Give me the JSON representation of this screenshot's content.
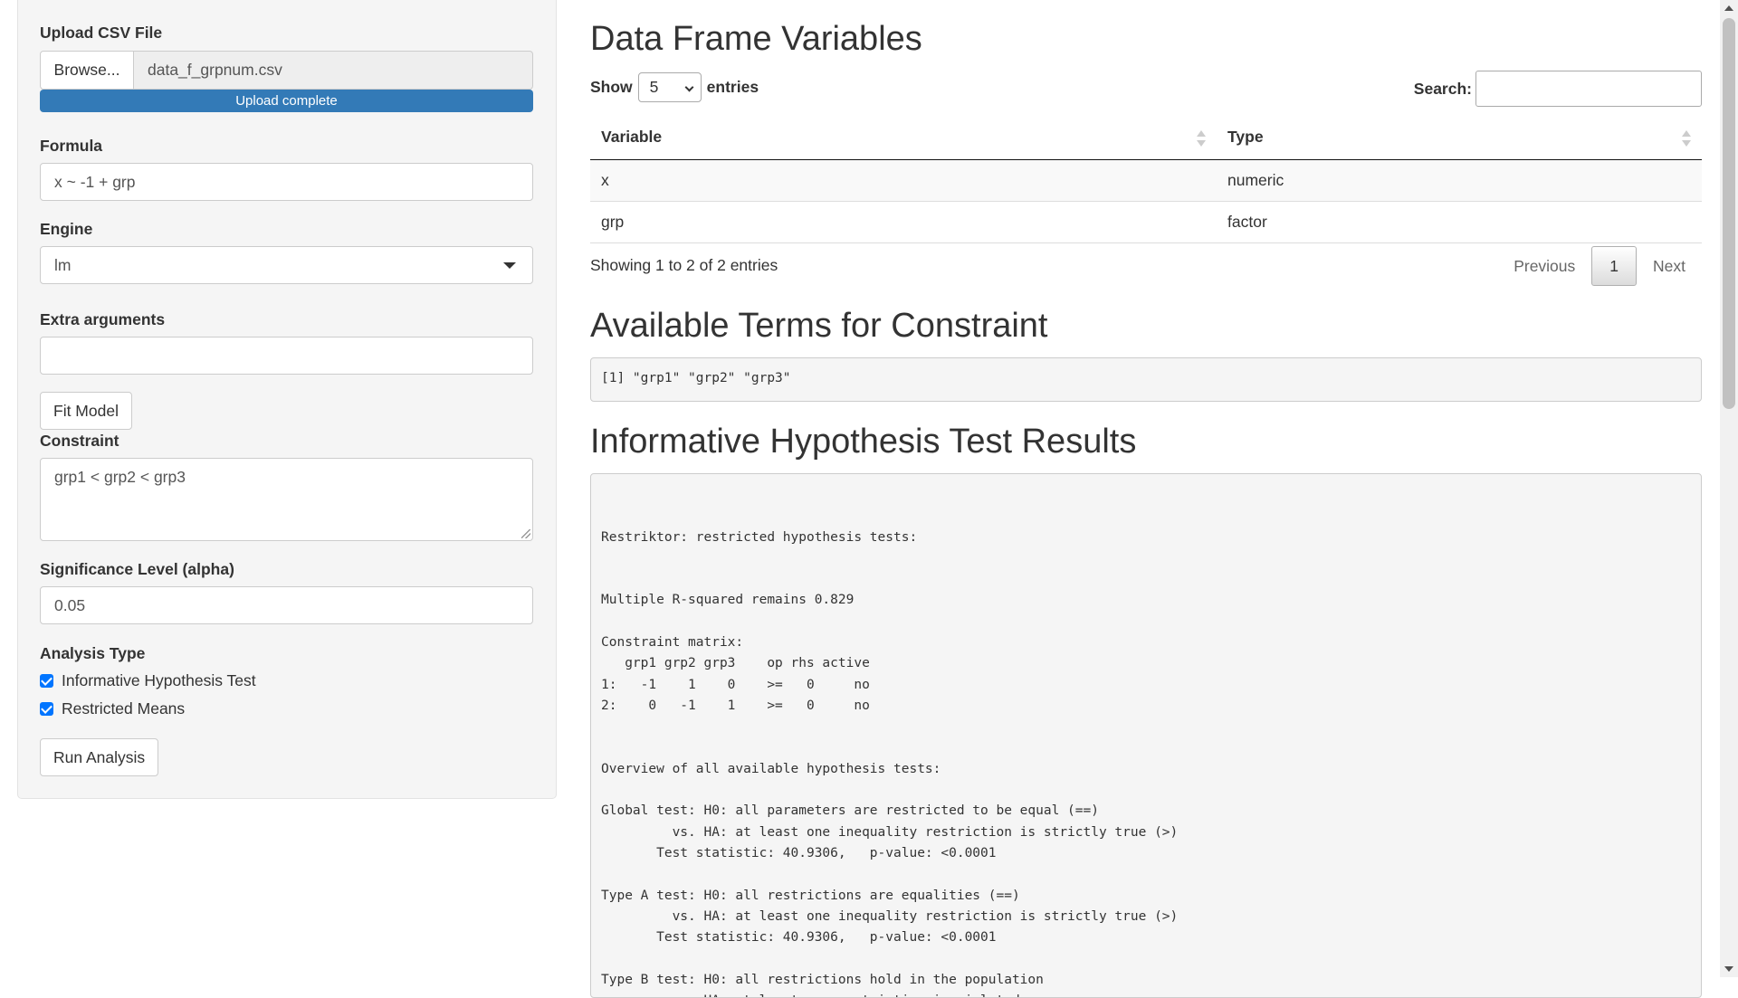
{
  "sidebar": {
    "upload": {
      "label": "Upload CSV File",
      "browse_label": "Browse...",
      "file_name": "data_f_grpnum.csv",
      "progress_text": "Upload complete",
      "progress_percent": 100
    },
    "formula": {
      "label": "Formula",
      "value": "x ~ -1 + grp"
    },
    "engine": {
      "label": "Engine",
      "value": "lm"
    },
    "extra_args": {
      "label": "Extra arguments",
      "value": ""
    },
    "fit_button": "Fit Model",
    "constraint": {
      "label": "Constraint",
      "value": "grp1 < grp2 < grp3"
    },
    "alpha": {
      "label": "Significance Level (alpha)",
      "value": "0.05"
    },
    "analysis_type": {
      "label": "Analysis Type",
      "options": [
        {
          "label": "Informative Hypothesis Test",
          "checked": true
        },
        {
          "label": "Restricted Means",
          "checked": true
        }
      ]
    },
    "run_button": "Run Analysis"
  },
  "main": {
    "df_title": "Data Frame Variables",
    "show_label": "Show",
    "entries_value": "5",
    "entries_label": "entries",
    "search_label": "Search:",
    "table": {
      "headers": [
        "Variable",
        "Type"
      ],
      "rows": [
        [
          "x",
          "numeric"
        ],
        [
          "grp",
          "factor"
        ]
      ]
    },
    "info": "Showing 1 to 2 of 2 entries",
    "pager": {
      "previous": "Previous",
      "current": "1",
      "next": "Next"
    },
    "terms_title": "Available Terms for Constraint",
    "terms_output": "[1] \"grp1\" \"grp2\" \"grp3\"",
    "results_title": "Informative Hypothesis Test Results",
    "results_output": "\n\nRestriktor: restricted hypothesis tests:\n\n\nMultiple R-squared remains 0.829\n\nConstraint matrix:\n   grp1 grp2 grp3    op rhs active\n1:   -1    1    0    >=   0     no\n2:    0   -1    1    >=   0     no\n\n\nOverview of all available hypothesis tests:\n\nGlobal test: H0: all parameters are restricted to be equal (==)\n         vs. HA: at least one inequality restriction is strictly true (>)\n       Test statistic: 40.9306,   p-value: <0.0001\n\nType A test: H0: all restrictions are equalities (==)\n         vs. HA: at least one inequality restriction is strictly true (>)\n       Test statistic: 40.9306,   p-value: <0.0001\n\nType B test: H0: all restrictions hold in the population\n         vs. HA: at least one restriction is violated"
  },
  "colors": {
    "primary": "#337ab7",
    "checkbox": "#0075ff",
    "sidebar_bg": "#f5f5f5"
  }
}
